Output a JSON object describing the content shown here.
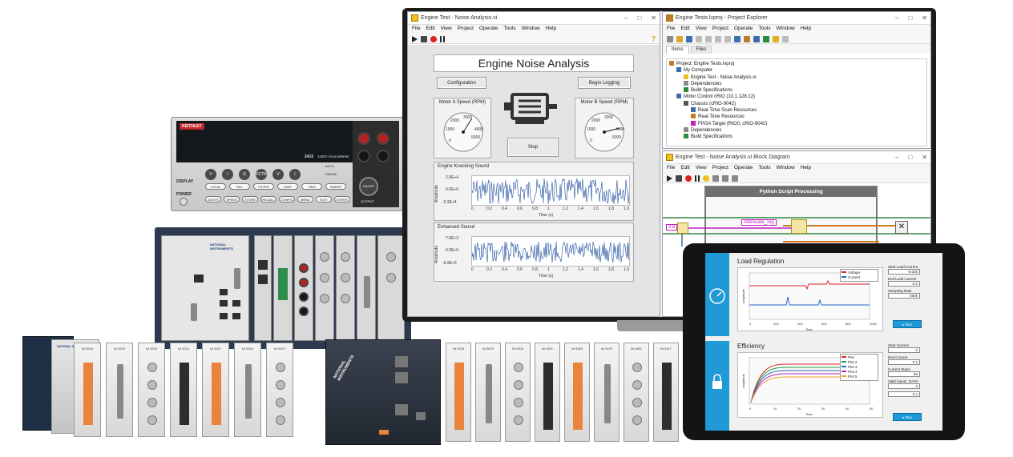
{
  "vi_window": {
    "title": "Engine Test - Noise Analysis.vi",
    "menu": [
      "File",
      "Edit",
      "View",
      "Project",
      "Operate",
      "Tools",
      "Window",
      "Help"
    ],
    "panel_title": "Engine Noise Analysis",
    "config_button": "Configuration",
    "logging_button": "Begin Logging",
    "stop_button": "Stop",
    "gauge_a": {
      "label": "Motor A Speed (RPM)",
      "ticks": [
        "1000",
        "2000",
        "3000",
        "4000",
        "5000",
        "0"
      ],
      "value_fraction": 0.62
    },
    "gauge_b": {
      "label": "Motor B Speed (RPM)",
      "ticks": [
        "1000",
        "2000",
        "3000",
        "4000",
        "5000",
        "0"
      ],
      "value_fraction": 0.78
    },
    "graph1": {
      "title": "Engine Knocking Sound",
      "ylabel": "Amplitude",
      "xlabel": "Time (s)",
      "yticks": [
        "2.9E+4",
        "0.0E+0",
        "-3.3E+4"
      ],
      "xticks": [
        "0",
        "0.2",
        "0.4",
        "0.6",
        "0.8",
        "1",
        "1.2",
        "1.4",
        "1.6",
        "1.8",
        "1.9"
      ]
    },
    "graph2": {
      "title": "Enhanced Sound",
      "ylabel": "Amplitude",
      "xlabel": "Time (s)",
      "yticks": [
        "7.6E+3",
        "0.0E+0",
        "-6.9E+3"
      ],
      "xticks": [
        "0",
        "0.2",
        "0.4",
        "0.6",
        "0.8",
        "1",
        "1.2",
        "1.4",
        "1.6",
        "1.8",
        "1.9"
      ]
    }
  },
  "project_window": {
    "title": "Engine Tests.lvproj - Project Explorer",
    "menu": [
      "File",
      "Edit",
      "View",
      "Project",
      "Operate",
      "Tools",
      "Window",
      "Help"
    ],
    "tabs": [
      "Items",
      "Files"
    ],
    "tree": [
      {
        "label": "Project: Engine Tests.lvproj",
        "level": 0
      },
      {
        "label": "My Computer",
        "level": 1
      },
      {
        "label": "Engine Test - Noise Analysis.vi",
        "level": 2
      },
      {
        "label": "Dependencies",
        "level": 2
      },
      {
        "label": "Build Specifications",
        "level": 2
      },
      {
        "label": "Motor Control cRIO (10.1.128.12)",
        "level": 1
      },
      {
        "label": "Chassis (cRIO-9042)",
        "level": 2
      },
      {
        "label": "Real-Time Scan Resources",
        "level": 3
      },
      {
        "label": "Real-Time Resources",
        "level": 3
      },
      {
        "label": "FPGA Target (RIO0, cRIO-9042)",
        "level": 3
      },
      {
        "label": "Dependencies",
        "level": 2
      },
      {
        "label": "Build Specifications",
        "level": 2
      }
    ]
  },
  "block_diagram": {
    "title": "Engine Test - Noise Analysis.vi Block Diagram",
    "menu": [
      "File",
      "Edit",
      "View",
      "Project",
      "Operate",
      "Tools",
      "Window",
      "Help"
    ],
    "frame_title": "Python Script Processing",
    "node_label": "Attenuate_Sig",
    "constant": "3.6"
  },
  "keithley": {
    "brand": "KEITHLEY",
    "model": "2410",
    "model_desc": "1100V SourceMeter",
    "buttons_row1": [
      "V",
      "I",
      "Ω",
      "FCTN",
      "V",
      "I"
    ],
    "buttons_row2": [
      "LOCAL",
      "REL",
      "FILTER",
      "LIMIT",
      "TRIG",
      "SWEEP"
    ],
    "buttons_row3": [
      "DIGITS",
      "SPEED",
      "STORE",
      "RECALL",
      "CONFIG",
      "MENU",
      "EXIT",
      "ENTER"
    ],
    "side_labels": [
      "DISPLAY",
      "POWER"
    ],
    "right_labels": [
      "AUTO",
      "RANGE",
      "ON/OFF",
      "OUTPUT"
    ]
  },
  "pxi": {
    "brand": "NATIONAL INSTRUMENTS"
  },
  "crio_left": {
    "brand": "NATIONAL INSTRUMENTS",
    "modules": [
      "NI 9205",
      "NI 9223",
      "NI 9215",
      "NI 9213",
      "NI 9237",
      "NI 9263",
      "NI 9472"
    ]
  },
  "crio_right": {
    "brand": "NATIONAL INSTRUMENTS",
    "modules": [
      "NI 9229",
      "NI 9870",
      "NI 9205",
      "NI 9401",
      "NI 9263",
      "NI 9375",
      "NI 9481",
      "NI 9217"
    ]
  },
  "tablet": {
    "section1": {
      "title": "Load Regulation",
      "legend": [
        "Voltage",
        "Current"
      ],
      "fields": [
        {
          "label": "Start Load Current",
          "value": "-0.025"
        },
        {
          "label": "End Load Current",
          "value": "-0.2"
        },
        {
          "label": "Sampling Rate",
          "value": "500k"
        }
      ],
      "button": "Run",
      "xticks": [
        "0",
        "200",
        "400",
        "600",
        "800",
        "1000"
      ],
      "xlabel": "Time",
      "ylabel": "Amplitude"
    },
    "section2": {
      "title": "Efficiency",
      "legend": [
        "Plot",
        "Plot 2",
        "Plot 3",
        "Plot 4",
        "Plot 5"
      ],
      "fields": [
        {
          "label": "Start Current",
          "value": "0"
        },
        {
          "label": "End Current",
          "value": "0.2"
        },
        {
          "label": "Current Steps",
          "value": "50"
        },
        {
          "label": "Valid Inputs: 3V-5V",
          "value": "3"
        },
        {
          "label": "",
          "value": "3.4"
        }
      ],
      "button": "Run",
      "xticks": [
        "0",
        "10",
        "20",
        "30",
        "40",
        "50"
      ],
      "xlabel": "Time",
      "ylabel": "Amplitude"
    }
  },
  "colors": {
    "accent_blue": "#1f9ad6",
    "labview_yellow": "#f0c020",
    "orange_terminal": "#e8843b",
    "signal_blue": "#1f4f9e"
  }
}
